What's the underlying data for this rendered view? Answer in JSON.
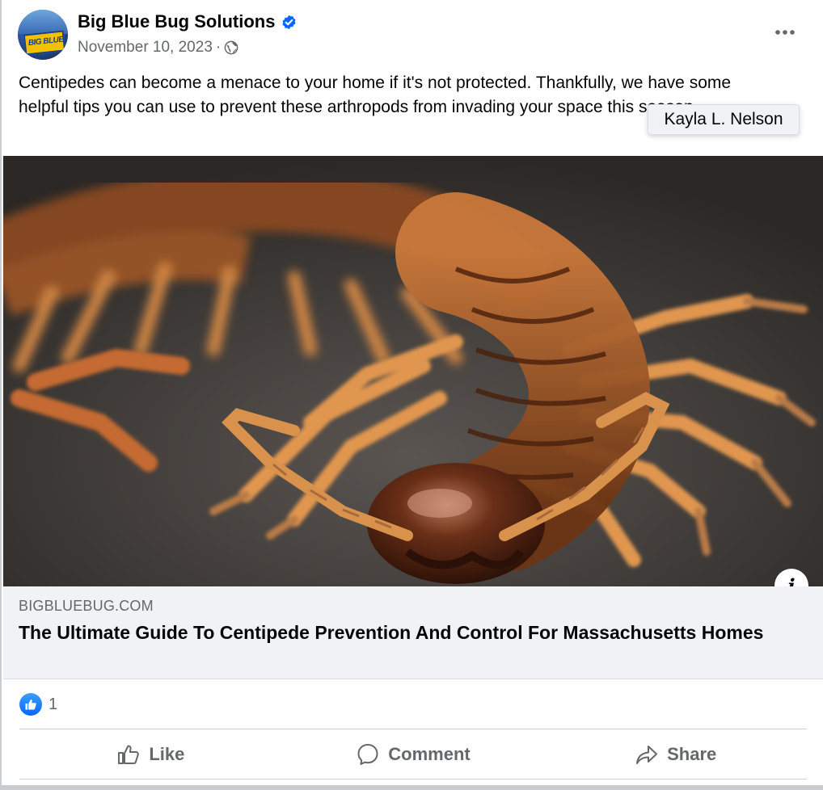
{
  "post": {
    "page_name": "Big Blue Bug Solutions",
    "date": "November 10, 2023",
    "separator": "·",
    "avatar_sign_text": "BIG BLUE BUG SOLUTIONS",
    "text": "Centipedes can become a menace to your home if it's not protected. Thankfully, we have some helpful tips you can use to prevent these arthropods from invading your space this season.",
    "tooltip": "Kayla L. Nelson"
  },
  "link_preview": {
    "domain": "BIGBLUEBUG.COM",
    "headline": "The Ultimate Guide To Centipede Prevention And Control For Massachusetts Homes",
    "info_glyph": "i"
  },
  "reactions": {
    "count": "1"
  },
  "actions": {
    "like": "Like",
    "comment": "Comment",
    "share": "Share"
  },
  "icons": {
    "verified": "verified-badge-icon",
    "audience": "globe-icon",
    "menu": "more-dots-icon",
    "like_reaction": "thumbs-up-icon"
  },
  "colors": {
    "brand_blue": "#0866ff",
    "secondary_text": "#65676b",
    "link_bg": "#f0f2f5"
  }
}
